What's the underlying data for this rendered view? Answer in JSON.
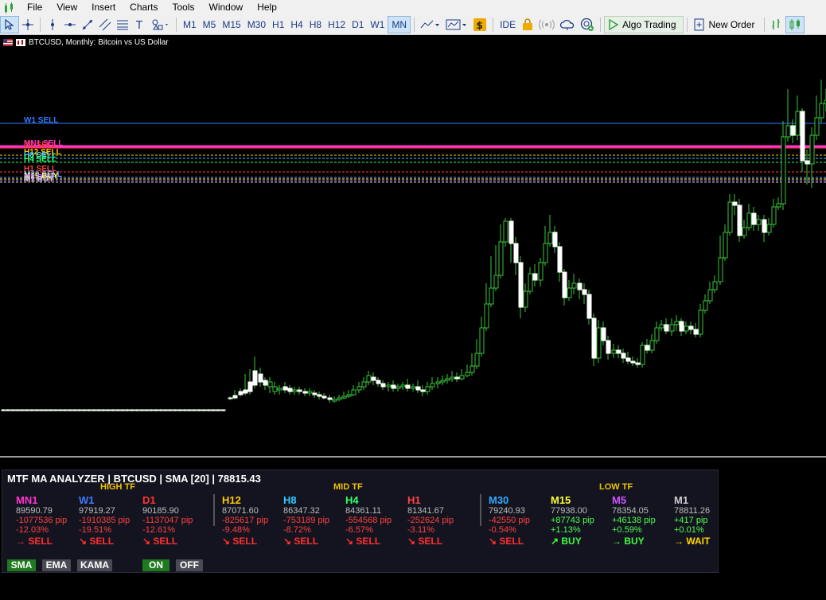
{
  "menu": [
    "File",
    "View",
    "Insert",
    "Charts",
    "Tools",
    "Window",
    "Help"
  ],
  "toolbar": {
    "timeframes": [
      "M1",
      "M5",
      "M15",
      "M30",
      "H1",
      "H4",
      "H8",
      "H12",
      "D1",
      "W1",
      "MN"
    ],
    "active_timeframe": "MN",
    "ide_label": "IDE",
    "algo_label": "Algo Trading",
    "new_order_label": "New Order"
  },
  "chart": {
    "symbol_title": "BTCUSD, Monthly:  Bitcoin vs US Dollar",
    "levels": [
      {
        "label": "W1 SELL",
        "color": "#2f7bff"
      },
      {
        "label": "MN1 SELL",
        "color": "#ff33cc"
      },
      {
        "label": "D1 SELL",
        "color": "#ff3333"
      },
      {
        "label": "H12 SELL",
        "color": "#ffcc00"
      },
      {
        "label": "H8 SELL",
        "color": "#33ccff"
      },
      {
        "label": "H4 SELL",
        "color": "#33ff66"
      },
      {
        "label": "H1 SELL",
        "color": "#ff4444"
      },
      {
        "label": "M30 SELL",
        "color": "#66a3ff"
      },
      {
        "label": "M15 BUY",
        "color": "#ffff66"
      },
      {
        "label": "M5 BUY",
        "color": "#cc66ff"
      },
      {
        "label": "M1 BUY",
        "color": "#cccccc"
      }
    ]
  },
  "panel": {
    "header": "MTF MA ANALYZER  |  BTCUSD  |  SMA [20]  |  78815.43",
    "groups": {
      "high": "HIGH TF",
      "mid": "MID TF",
      "low": "LOW TF"
    },
    "columns": [
      {
        "tf": "MN1",
        "color": "#ff33cc",
        "price": "89590.79",
        "pip": "-1077536 pip",
        "pct": "-12.03%",
        "signal": "→ SELL",
        "dir": "sell"
      },
      {
        "tf": "W1",
        "color": "#3d7dff",
        "price": "97919.27",
        "pip": "-1910385 pip",
        "pct": "-19.51%",
        "signal": "↘ SELL",
        "dir": "sell"
      },
      {
        "tf": "D1",
        "color": "#ff3333",
        "price": "90185.90",
        "pip": "-1137047 pip",
        "pct": "-12.61%",
        "signal": "↘ SELL",
        "dir": "sell"
      },
      {
        "tf": "H12",
        "color": "#ffcc00",
        "price": "87071.60",
        "pip": "-825617 pip",
        "pct": "-9.48%",
        "signal": "↘ SELL",
        "dir": "sell"
      },
      {
        "tf": "H8",
        "color": "#33ccff",
        "price": "86347.32",
        "pip": "-753189 pip",
        "pct": "-8.72%",
        "signal": "↘ SELL",
        "dir": "sell"
      },
      {
        "tf": "H4",
        "color": "#33ff66",
        "price": "84361.11",
        "pip": "-554568 pip",
        "pct": "-6.57%",
        "signal": "↘ SELL",
        "dir": "sell"
      },
      {
        "tf": "H1",
        "color": "#ff4444",
        "price": "81341.67",
        "pip": "-252624 pip",
        "pct": "-3.11%",
        "signal": "↘ SELL",
        "dir": "sell"
      },
      {
        "tf": "M30",
        "color": "#33aaff",
        "price": "79240.93",
        "pip": "-42550 pip",
        "pct": "-0.54%",
        "signal": "↘ SELL",
        "dir": "sell"
      },
      {
        "tf": "M15",
        "color": "#ffff33",
        "price": "77938.00",
        "pip": "+87743 pip",
        "pct": "+1.13%",
        "signal": "↗ BUY",
        "dir": "buy"
      },
      {
        "tf": "M5",
        "color": "#cc55ff",
        "price": "78354.05",
        "pip": "+46138 pip",
        "pct": "+0.59%",
        "signal": "→ BUY",
        "dir": "buy"
      },
      {
        "tf": "M1",
        "color": "#cccccc",
        "price": "78811.26",
        "pip": "+417 pip",
        "pct": "+0.01%",
        "signal": "→ WAIT",
        "dir": "wait"
      }
    ],
    "ma_buttons": [
      "SMA",
      "EMA",
      "KAMA"
    ],
    "active_ma": "SMA",
    "on_label": "ON",
    "off_label": "OFF"
  }
}
